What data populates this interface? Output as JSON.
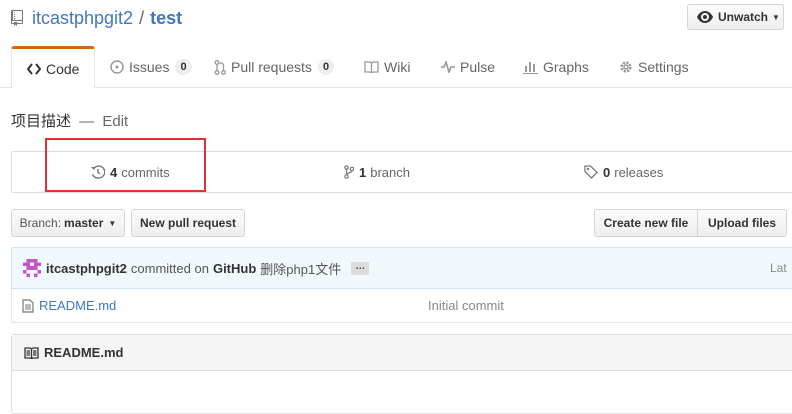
{
  "repo": {
    "owner": "itcastphpgit2",
    "separator": "/",
    "name": "test"
  },
  "watch": {
    "label": "Unwatch"
  },
  "tabs": [
    {
      "label": "Code",
      "icon": "code-icon",
      "selected": true
    },
    {
      "label": "Issues",
      "icon": "issue-icon",
      "count": "0"
    },
    {
      "label": "Pull requests",
      "icon": "pull-request-icon",
      "count": "0"
    },
    {
      "label": "Wiki",
      "icon": "book-icon"
    },
    {
      "label": "Pulse",
      "icon": "pulse-icon"
    },
    {
      "label": "Graphs",
      "icon": "graph-icon"
    },
    {
      "label": "Settings",
      "icon": "gear-icon"
    }
  ],
  "description": {
    "text": "项目描述",
    "dash": "—",
    "edit_label": "Edit"
  },
  "summary": {
    "commits": {
      "count": "4",
      "label": "commits",
      "icon": "history-icon"
    },
    "branches": {
      "count": "1",
      "label": "branch",
      "icon": "branch-icon"
    },
    "releases": {
      "count": "0",
      "label": "releases",
      "icon": "tag-icon"
    }
  },
  "toolbar": {
    "branch_prefix": "Branch:",
    "branch_name": "master",
    "new_pull_request": "New pull request",
    "create_new_file": "Create new file",
    "upload_files": "Upload files"
  },
  "commit": {
    "author": "itcastphpgit2",
    "verb": "committed on",
    "site": "GitHub",
    "message": "删除php1文件",
    "ellipsis": "…",
    "latest": "Lat"
  },
  "files": [
    {
      "name": "README.md",
      "message": "Initial commit",
      "icon": "file-icon"
    }
  ],
  "readme": {
    "title": "README.md",
    "icon": "book-icon"
  },
  "colors": {
    "link": "#4078c0",
    "tab_accent": "#d26911",
    "highlight": "#e03232",
    "commit_bar_bg": "#f2f9fc"
  }
}
